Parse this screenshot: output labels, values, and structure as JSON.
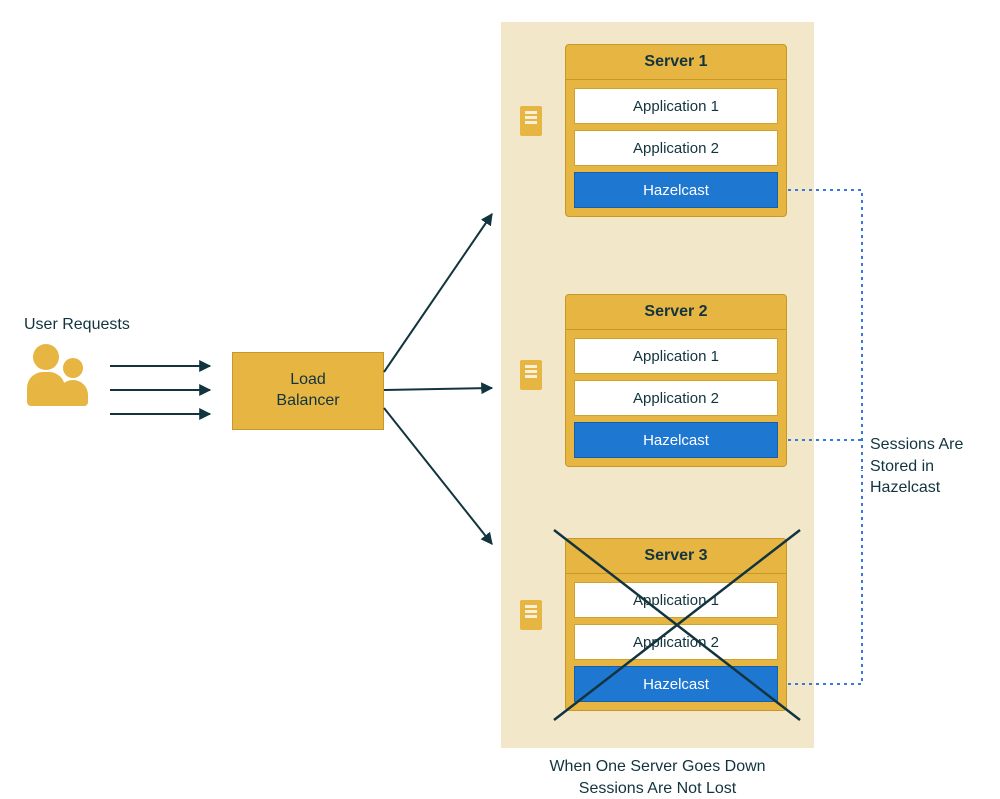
{
  "userRequestsLabel": "User Requests",
  "loadBalancer": {
    "label": "Load\nBalancer"
  },
  "servers": [
    {
      "title": "Server 1",
      "app1": "Application 1",
      "app2": "Application 2",
      "hz": "Hazelcast"
    },
    {
      "title": "Server 2",
      "app1": "Application 1",
      "app2": "Application 2",
      "hz": "Hazelcast"
    },
    {
      "title": "Server 3",
      "app1": "Application 1",
      "app2": "Application 2",
      "hz": "Hazelcast"
    }
  ],
  "sessionsNote": "Sessions Are\nStored in\nHazelcast",
  "bottomNote": "When One Server Goes Down\nSessions Are Not Lost",
  "colors": {
    "gold": "#e6b542",
    "goldBorder": "#c79826",
    "panel": "#f2e8c9",
    "ink": "#12343f",
    "blue": "#1e77d0",
    "dashBlue": "#3a78d6"
  }
}
